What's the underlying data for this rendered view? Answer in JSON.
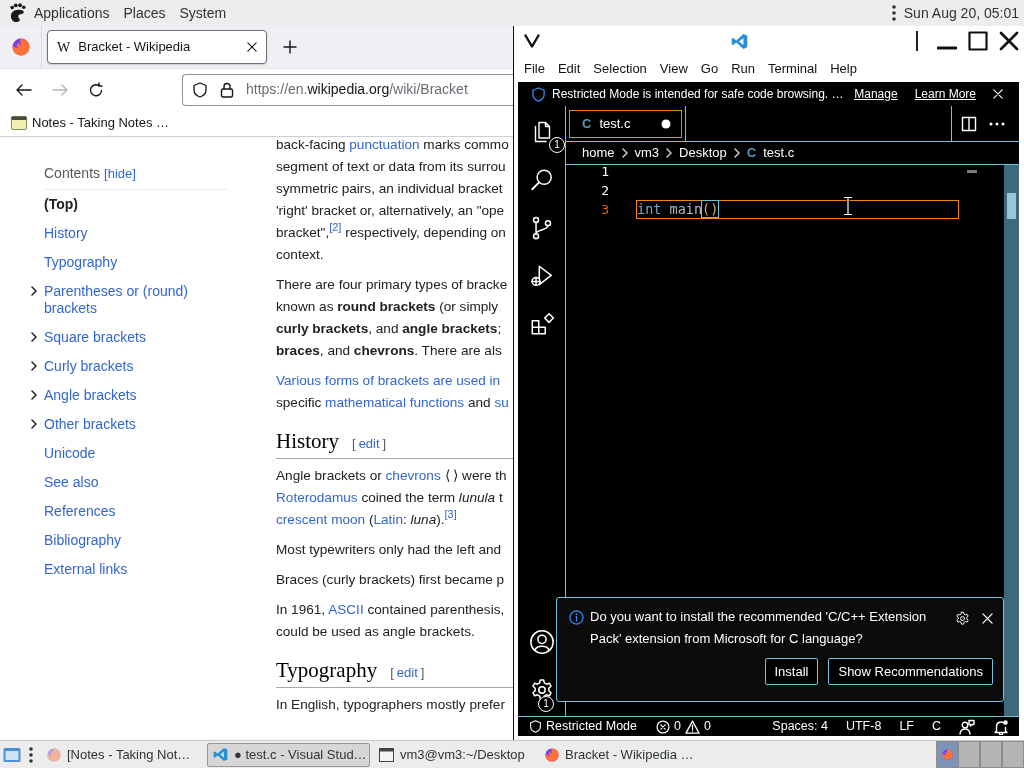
{
  "top_panel": {
    "menus": [
      "Applications",
      "Places",
      "System"
    ],
    "clock": "Sun Aug 20, 05:01"
  },
  "browser": {
    "tabs": [
      {
        "favicon": "W",
        "title": "Bracket - Wikipedia",
        "selected": true
      }
    ],
    "navigation": {
      "back": {
        "disabled": false
      },
      "forward": {
        "disabled": true
      }
    },
    "address": {
      "prefix": "https://en.",
      "domain": "wikipedia.org",
      "path": "/wiki/Bracket"
    },
    "bookmarks": [
      {
        "title": "Notes - Taking Notes …"
      }
    ],
    "toc": {
      "title": "Contents",
      "toggle": "[hide]",
      "items": [
        {
          "label": "(Top)",
          "selected": true
        },
        {
          "label": "History",
          "selected": false
        },
        {
          "label": "Typography",
          "selected": false
        },
        {
          "label": "Parentheses or (round) brackets",
          "selected": false,
          "expanded": false
        },
        {
          "label": "Square brackets",
          "selected": false,
          "expanded": false
        },
        {
          "label": "Curly brackets",
          "selected": false,
          "expanded": false
        },
        {
          "label": "Angle brackets",
          "selected": false,
          "expanded": false
        },
        {
          "label": "Other brackets",
          "selected": false,
          "expanded": false
        },
        {
          "label": "Unicode",
          "selected": false
        },
        {
          "label": "See also",
          "selected": false
        },
        {
          "label": "References",
          "selected": false
        },
        {
          "label": "Bibliography",
          "selected": false
        },
        {
          "label": "External links",
          "selected": false
        }
      ]
    },
    "article": [
      {
        "kind": "paragraph",
        "lines": [
          [
            {
              "kind": "text",
              "text": "back-facing "
            },
            {
              "kind": "link",
              "text": "punctuation"
            },
            {
              "kind": "text",
              "text": " marks commo"
            }
          ],
          [
            {
              "kind": "text",
              "text": "segment of text or data from its surrou"
            }
          ],
          [
            {
              "kind": "text",
              "text": "symmetric pairs, an individual bracket"
            }
          ],
          [
            {
              "kind": "text",
              "text": "'right' bracket or, alternatively, an \"ope"
            }
          ],
          [
            {
              "kind": "text",
              "text": "bracket\","
            },
            {
              "kind": "ref",
              "text": "[2]"
            },
            {
              "kind": "text",
              "text": " respectively, depending on"
            }
          ],
          [
            {
              "kind": "text",
              "text": "context."
            }
          ]
        ]
      },
      {
        "kind": "paragraph",
        "lines": [
          [
            {
              "kind": "text",
              "text": "There are four primary types of bracke"
            }
          ],
          [
            {
              "kind": "text",
              "text": "known as **round brackets** (or simply"
            }
          ],
          [
            {
              "kind": "text",
              "text": "**curly brackets**, and **angle brackets**;"
            }
          ],
          [
            {
              "kind": "text",
              "text": "**braces**, and **chevrons**. There are als"
            }
          ]
        ]
      },
      {
        "kind": "paragraph",
        "lines": [
          [
            {
              "kind": "link",
              "text": "Various forms of brackets are used in"
            }
          ],
          [
            {
              "kind": "text",
              "text": "specific "
            },
            {
              "kind": "link",
              "text": "mathematical functions"
            },
            {
              "kind": "text",
              "text": " and "
            },
            {
              "kind": "link",
              "text": "su"
            }
          ]
        ]
      },
      {
        "kind": "heading",
        "title": "History",
        "edit": {
          "open": "[",
          "label": "edit",
          "close": "]"
        }
      },
      {
        "kind": "paragraph",
        "lines": [
          [
            {
              "kind": "text",
              "text": "Angle brackets or "
            },
            {
              "kind": "link",
              "text": "chevrons"
            },
            {
              "kind": "text",
              "text": " ⟨ ⟩ were th"
            }
          ],
          [
            {
              "kind": "link",
              "text": "Roterodamus"
            },
            {
              "kind": "text",
              "text": " coined the term *lunula* t"
            }
          ],
          [
            {
              "kind": "link",
              "text": "crescent moon"
            },
            {
              "kind": "text",
              "text": " ("
            },
            {
              "kind": "link",
              "text": "Latin"
            },
            {
              "kind": "text",
              "text": ": *luna*)."
            },
            {
              "kind": "ref",
              "text": "[3]"
            }
          ]
        ]
      },
      {
        "kind": "paragraph",
        "lines": [
          [
            {
              "kind": "text",
              "text": "Most typewriters only had the left and"
            }
          ]
        ]
      },
      {
        "kind": "paragraph",
        "lines": [
          [
            {
              "kind": "text",
              "text": "Braces (curly brackets) first became p"
            }
          ]
        ]
      },
      {
        "kind": "paragraph",
        "lines": [
          [
            {
              "kind": "text",
              "text": "In 1961, "
            },
            {
              "kind": "link",
              "text": "ASCII"
            },
            {
              "kind": "text",
              "text": " contained parenthesis,"
            }
          ],
          [
            {
              "kind": "text",
              "text": "could be used as angle brackets."
            }
          ]
        ]
      },
      {
        "kind": "heading",
        "title": "Typography",
        "edit": {
          "open": "[",
          "label": "edit",
          "close": "]"
        }
      },
      {
        "kind": "paragraph",
        "lines": [
          [
            {
              "kind": "text",
              "text": "In English, typographers mostly prefer"
            }
          ]
        ]
      }
    ]
  },
  "code_editor": {
    "menus": [
      "File",
      "Edit",
      "Selection",
      "View",
      "Go",
      "Run",
      "Terminal",
      "Help"
    ],
    "banner": {
      "message": "Restricted Mode is intended for safe code browsing. …",
      "actions": [
        "Manage",
        "Learn More"
      ]
    },
    "activity_bar": {
      "top": [
        {
          "kind": "explorer",
          "badge": "1"
        },
        {
          "kind": "search"
        },
        {
          "kind": "source_control"
        },
        {
          "kind": "run_debug"
        },
        {
          "kind": "extensions"
        }
      ],
      "bottom": [
        {
          "kind": "accounts"
        },
        {
          "kind": "settings",
          "badge": "1"
        }
      ]
    },
    "tabs": [
      {
        "icon_letter": "C",
        "title": "test.c",
        "selected": true,
        "dirty": true
      }
    ],
    "breadcrumbs": [
      {
        "label": "home"
      },
      {
        "label": "vm3"
      },
      {
        "label": "Desktop"
      },
      {
        "label": "test.c",
        "icon_letter": "C"
      }
    ],
    "lines": [
      {
        "number": "1",
        "current": false
      },
      {
        "number": "2",
        "current": false
      },
      {
        "number": "3",
        "current": true,
        "tokens": [
          {
            "kind": "keyword",
            "text": "int"
          },
          {
            "kind": "plain",
            "text": " main"
          },
          {
            "kind": "bracket",
            "text": "()"
          }
        ]
      }
    ],
    "notification": {
      "message": "Do you want to install the recommended 'C/C++ Extension Pack' extension from Microsoft for C language?",
      "actions": [
        {
          "label": "Install"
        },
        {
          "label": "Show Recommendations"
        }
      ]
    },
    "status_bar": {
      "mode": "Restricted Mode",
      "errors": "0",
      "warnings": "0",
      "items": [
        "Spaces: 4",
        "UTF-8",
        "LF",
        "C"
      ]
    }
  },
  "taskbar": {
    "windows": [
      {
        "kind": "browser",
        "title": "[Notes - Taking Not…",
        "minimized": true,
        "selected": false
      },
      {
        "kind": "editor",
        "title": "● test.c - Visual Stud…",
        "minimized": false,
        "selected": true
      },
      {
        "kind": "terminal",
        "title": "vm3@vm3:~/Desktop",
        "minimized": false,
        "selected": false
      },
      {
        "kind": "browser",
        "title": "Bracket - Wikipedia …",
        "minimized": false,
        "selected": false
      }
    ],
    "workspaces": [
      {
        "selected": true,
        "windows": [
          {
            "kind": "browser"
          }
        ]
      },
      {
        "selected": false
      },
      {
        "selected": false
      },
      {
        "selected": false
      }
    ]
  }
}
